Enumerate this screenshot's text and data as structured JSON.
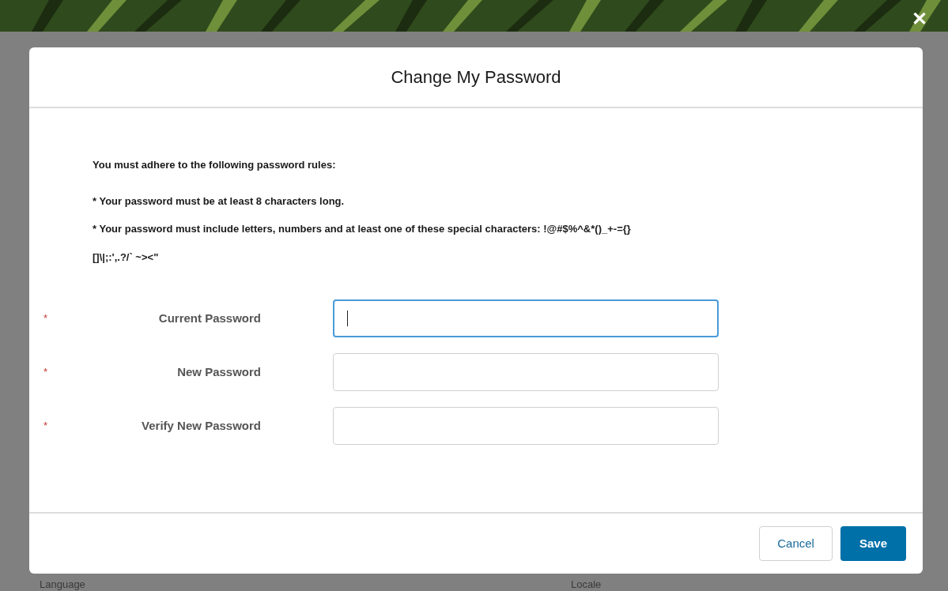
{
  "background": {
    "labels": [
      "Language",
      "Locale"
    ]
  },
  "close_button": {
    "label": "✕"
  },
  "dialog": {
    "title": "Change My Password",
    "rules": [
      "You must adhere to the following password rules:",
      "* Your password must be at least 8 characters long.",
      "* Your password must include letters, numbers and at least one of these special characters: !@#$%^&*()_+-={}",
      "[]\\|;:',.?/` ~><\""
    ],
    "fields": [
      {
        "label": "Current Password",
        "required_mark": "*",
        "focused": true
      },
      {
        "label": "New Password",
        "required_mark": "*",
        "focused": false
      },
      {
        "label": "Verify New Password",
        "required_mark": "*",
        "focused": false
      }
    ],
    "buttons": [
      {
        "label": "Cancel",
        "kind": "secondary"
      },
      {
        "label": "Save",
        "kind": "primary"
      }
    ]
  }
}
